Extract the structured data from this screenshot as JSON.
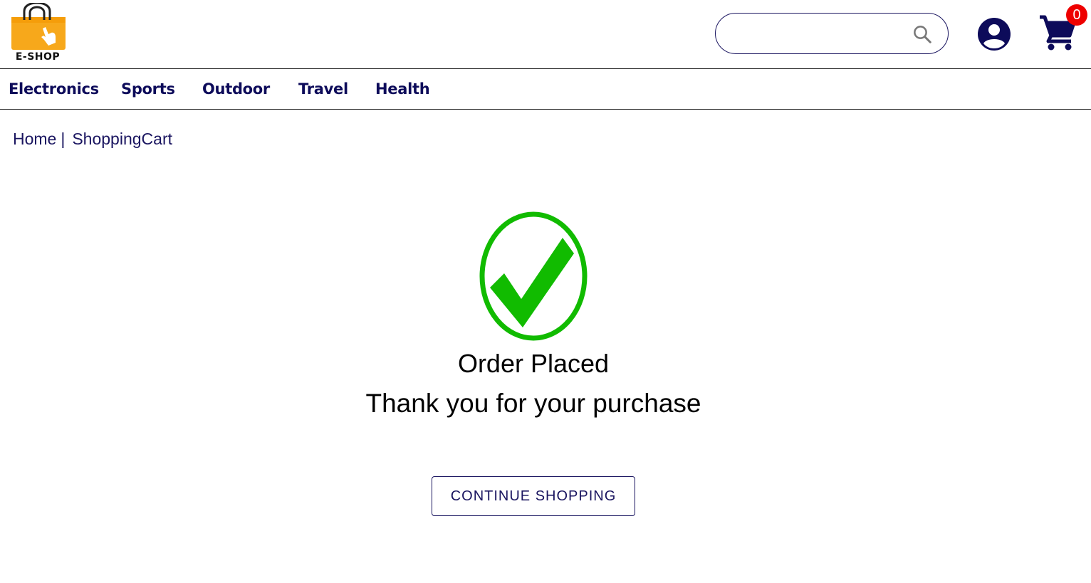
{
  "header": {
    "logo_text": "E-SHOP",
    "search": {
      "value": "",
      "placeholder": ""
    },
    "cart_count": "0"
  },
  "nav": {
    "categories": [
      "Electronics",
      "Sports",
      "Outdoor",
      "Travel",
      "Health"
    ]
  },
  "breadcrumb": {
    "home": "Home",
    "separator": "|",
    "current": "ShoppingCart"
  },
  "confirmation": {
    "title": "Order Placed",
    "subtitle": "Thank you for your purchase",
    "continue_label": "CONTINUE SHOPPING"
  },
  "icons": {
    "logo": "shopping-bag-icon",
    "search": "search-icon",
    "user": "account-circle-icon",
    "cart": "shopping-cart-icon",
    "success": "check-circle-icon"
  },
  "colors": {
    "primary": "#1a1560",
    "nav_text": "#0d0b5a",
    "badge": "#ee0000",
    "success": "#11bb00",
    "logo_bag": "#f7a81b"
  }
}
